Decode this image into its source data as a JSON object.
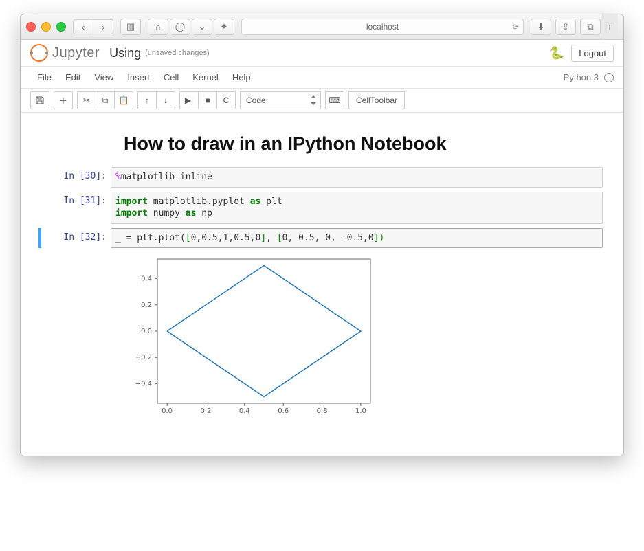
{
  "browser": {
    "address": "localhost"
  },
  "header": {
    "brand": "Jupyter",
    "notebook_name": "Using",
    "save_status": "(unsaved changes)",
    "logout": "Logout"
  },
  "menubar": {
    "items": [
      "File",
      "Edit",
      "View",
      "Insert",
      "Cell",
      "Kernel",
      "Help"
    ],
    "kernel": "Python 3"
  },
  "toolbar": {
    "celltype": "Code",
    "celltoolbar": "CellToolbar"
  },
  "notebook": {
    "heading": "How to draw in an IPython Notebook",
    "cells": [
      {
        "prompt": "In [30]:",
        "code_html": "<span class='mag'>%</span>matplotlib inline"
      },
      {
        "prompt": "In [31]:",
        "code_html": "<span class='kw'>import</span> matplotlib.pyplot <span class='kw'>as</span> plt\n<span class='kw'>import</span> numpy <span class='kw'>as</span> np"
      },
      {
        "prompt": "In [32]:",
        "code_html": "_ = plt.plot(<span style='color:#080'>[</span>0,0.5,1,0.5,0<span style='color:#080'>]</span>, <span style='color:#080'>[</span>0, 0.5, 0, <span style='color:#666'>-</span>0.5,0<span style='color:#080'>]</span><span style='color:#080'>)</span>",
        "selected": true,
        "has_output": true
      }
    ]
  },
  "chart_data": {
    "type": "line",
    "x": [
      0,
      0.5,
      1,
      0.5,
      0
    ],
    "y": [
      0,
      0.5,
      0,
      -0.5,
      0
    ],
    "xlim": [
      -0.05,
      1.05
    ],
    "ylim": [
      -0.55,
      0.55
    ],
    "xticks": [
      0.0,
      0.2,
      0.4,
      0.6,
      0.8,
      1.0
    ],
    "yticks": [
      -0.4,
      -0.2,
      0.0,
      0.2,
      0.4
    ],
    "line_color": "#1f77b4"
  }
}
